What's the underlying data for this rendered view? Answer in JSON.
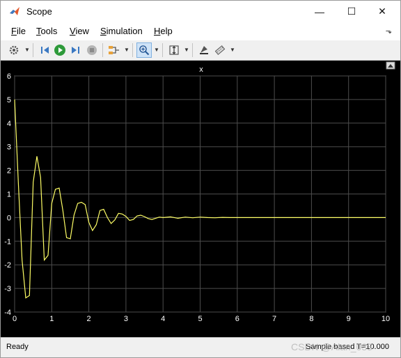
{
  "window": {
    "title": "Scope",
    "minimize": "—",
    "maximize": "☐",
    "close": "✕"
  },
  "menu": {
    "items": [
      "File",
      "Tools",
      "View",
      "Simulation",
      "Help"
    ],
    "underline": [
      "F",
      "T",
      "V",
      "S",
      "H"
    ]
  },
  "toolbar": {
    "icons": [
      "gear-icon",
      "step-back-icon",
      "run-icon",
      "step-forward-icon",
      "stop-icon",
      "signal-selector-icon",
      "zoom-icon",
      "autoscale-icon",
      "style-icon",
      "measure-icon"
    ]
  },
  "colors": {
    "plot_bg": "#000000",
    "line": "#ffff66",
    "grid": "#4d4d4d",
    "axis_text": "#ffffff"
  },
  "chart_data": {
    "type": "line",
    "title": "x",
    "xlim": [
      0,
      10
    ],
    "ylim": [
      -4,
      6
    ],
    "xticks": [
      0,
      1,
      2,
      3,
      4,
      5,
      6,
      7,
      8,
      9,
      10
    ],
    "yticks": [
      -4,
      -3,
      -2,
      -1,
      0,
      1,
      2,
      3,
      4,
      5,
      6
    ],
    "grid": true,
    "series": [
      {
        "x": [
          0,
          0.1,
          0.2,
          0.3,
          0.4,
          0.5,
          0.6,
          0.7,
          0.8,
          0.9,
          1.0,
          1.1,
          1.2,
          1.3,
          1.4,
          1.5,
          1.6,
          1.7,
          1.8,
          1.9,
          2.0,
          2.1,
          2.2,
          2.3,
          2.4,
          2.5,
          2.6,
          2.7,
          2.8,
          2.9,
          3.0,
          3.1,
          3.2,
          3.3,
          3.4,
          3.5,
          3.6,
          3.7,
          3.8,
          3.9,
          4.0,
          4.2,
          4.4,
          4.6,
          4.8,
          5.0,
          5.2,
          5.4,
          5.6,
          5.8,
          6.0,
          6.5,
          7.0,
          8.0,
          9.0,
          10.0
        ],
        "values": [
          5.0,
          1.5,
          -1.8,
          -3.4,
          -3.3,
          1.5,
          2.6,
          1.7,
          -1.8,
          -1.6,
          0.6,
          1.2,
          1.25,
          0.3,
          -0.85,
          -0.9,
          0.1,
          0.6,
          0.65,
          0.55,
          -0.2,
          -0.55,
          -0.3,
          0.3,
          0.35,
          0.0,
          -0.25,
          -0.1,
          0.18,
          0.15,
          0.05,
          -0.12,
          -0.08,
          0.07,
          0.1,
          0.04,
          -0.04,
          -0.08,
          -0.03,
          0.02,
          0.0,
          0.03,
          -0.03,
          0.02,
          -0.01,
          0.02,
          0.0,
          -0.01,
          0.01,
          0.0,
          0.0,
          0.0,
          0.0,
          0.0,
          0.0,
          0.0
        ]
      }
    ]
  },
  "status": {
    "left": "Ready",
    "right": "Sample based  T=10.000"
  },
  "watermark": "CSDN @Alan_033"
}
